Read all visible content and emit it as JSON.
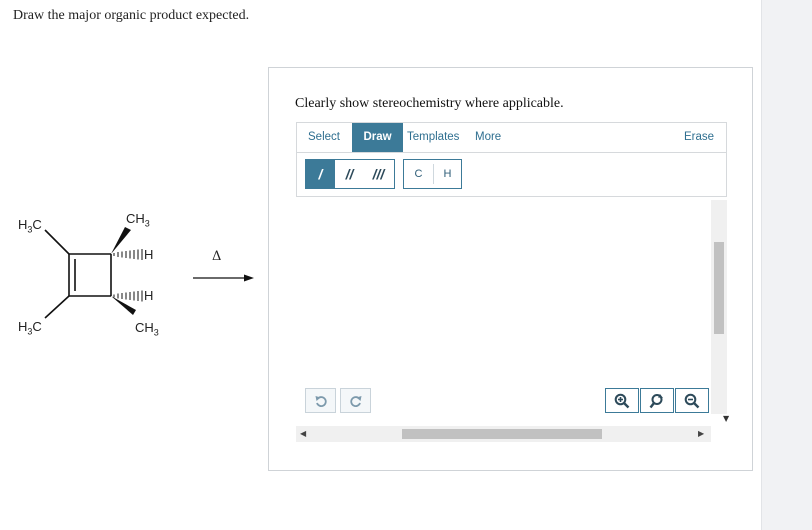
{
  "question": "Draw the major organic product expected.",
  "reaction": {
    "top_left_label": "H3C",
    "top_methyl_label": "CH3",
    "top_h_label": "H",
    "bottom_left_label": "H3C",
    "bottom_h_label": "H",
    "bottom_methyl_label": "CH3",
    "condition": "Δ"
  },
  "panel": {
    "instruction": "Clearly show stereochemistry where applicable.",
    "tabs": {
      "select": "Select",
      "draw": "Draw",
      "templates": "Templates",
      "more": "More",
      "erase": "Erase"
    },
    "bond_tools": [
      "/",
      "//",
      "///"
    ],
    "atom_tools": [
      "C",
      "H"
    ],
    "icons": {
      "undo": "undo-icon",
      "redo": "redo-icon",
      "zoom_in": "zoom-in-icon",
      "reset": "reset-view-icon",
      "zoom_out": "zoom-out-icon"
    }
  },
  "colors": {
    "accent": "#3c7a98",
    "gutter": "#f1f2f4"
  }
}
